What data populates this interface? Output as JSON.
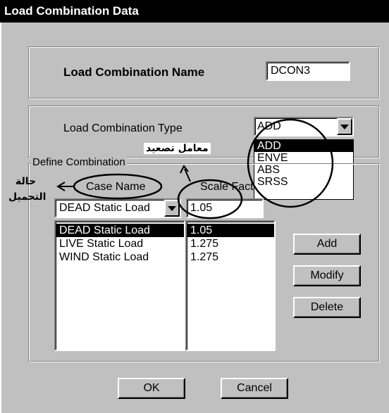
{
  "window": {
    "title": "Load Combination Data"
  },
  "name_group": {
    "label": "Load Combination Name",
    "value": "DCON3"
  },
  "type_group": {
    "label": "Load Combination Type",
    "selected": "ADD",
    "options": [
      "ADD",
      "ENVE",
      "ABS",
      "SRSS"
    ]
  },
  "define_group": {
    "legend": "Define Combination",
    "case_header": "Case Name",
    "scale_header": "Scale Fact",
    "case_dropdown_value": "DEAD Static Load",
    "scale_input_value": "1.05",
    "rows": [
      {
        "case": "DEAD Static Load",
        "scale": "1.05"
      },
      {
        "case": "LIVE Static Load",
        "scale": "1.275"
      },
      {
        "case": "WIND Static Load",
        "scale": "1.275"
      }
    ],
    "buttons": {
      "add": "Add",
      "modify": "Modify",
      "delete": "Delete"
    }
  },
  "footer": {
    "ok": "OK",
    "cancel": "Cancel"
  },
  "annotations": {
    "scale_factor_ar": "معامل تصعيد",
    "load_case_ar_line1": "حالة",
    "load_case_ar_line2": "التحميل"
  }
}
